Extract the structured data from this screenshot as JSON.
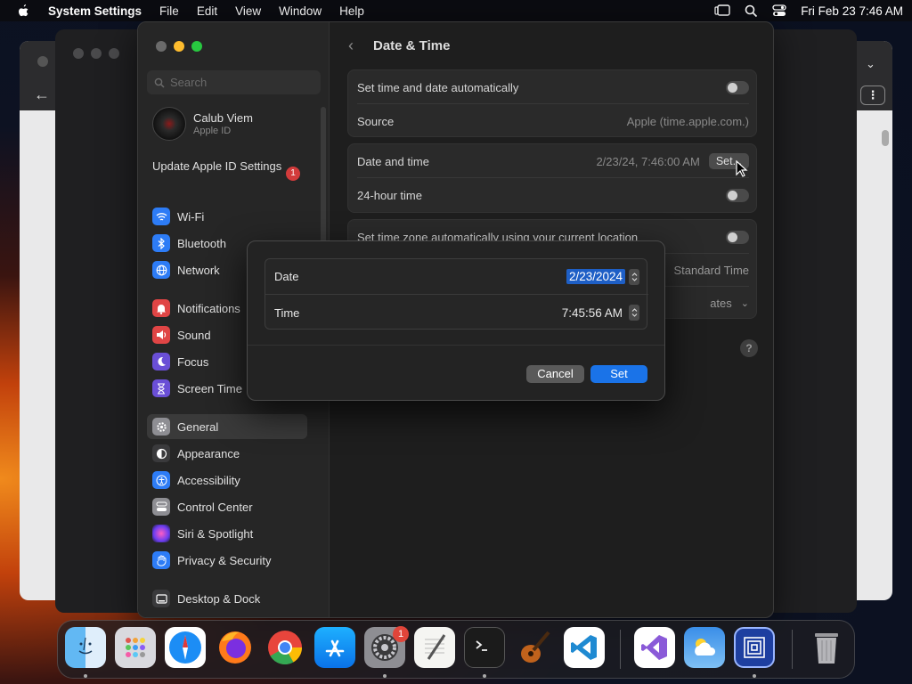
{
  "menubar": {
    "app_name": "System Settings",
    "menus": [
      "File",
      "Edit",
      "View",
      "Window",
      "Help"
    ],
    "clock": "Fri Feb 23  7:46 AM"
  },
  "sidebar": {
    "search_placeholder": "Search",
    "account": {
      "name": "Calub Viem",
      "subtitle": "Apple ID"
    },
    "update": {
      "label": "Update Apple ID Settings",
      "badge": "1"
    },
    "items": [
      {
        "label": "Wi-Fi",
        "icon": "wifi-icon",
        "color": "#2d7cf6"
      },
      {
        "label": "Bluetooth",
        "icon": "bluetooth-icon",
        "color": "#2d7cf6"
      },
      {
        "label": "Network",
        "icon": "globe-icon",
        "color": "#2d7cf6"
      },
      {
        "label": "Notifications",
        "icon": "bell-icon",
        "color": "#e04545"
      },
      {
        "label": "Sound",
        "icon": "speaker-icon",
        "color": "#e04545"
      },
      {
        "label": "Focus",
        "icon": "moon-icon",
        "color": "#6a4fd6"
      },
      {
        "label": "Screen Time",
        "icon": "hourglass-icon",
        "color": "#6a4fd6"
      },
      {
        "label": "General",
        "icon": "gear-icon",
        "color": "#8e8e93"
      },
      {
        "label": "Appearance",
        "icon": "appearance-icon",
        "color": "#3a3a3c"
      },
      {
        "label": "Accessibility",
        "icon": "accessibility-icon",
        "color": "#2d7cf6"
      },
      {
        "label": "Control Center",
        "icon": "control-center-icon",
        "color": "#8e8e93"
      },
      {
        "label": "Siri & Spotlight",
        "icon": "siri-icon",
        "color": "#b044d8"
      },
      {
        "label": "Privacy & Security",
        "icon": "hand-icon",
        "color": "#2d7cf6"
      },
      {
        "label": "Desktop & Dock",
        "icon": "dock-icon",
        "color": "#3a3a3c"
      }
    ],
    "selected": "General"
  },
  "content": {
    "title": "Date & Time",
    "rows": {
      "auto_set": {
        "label": "Set time and date automatically"
      },
      "source": {
        "label": "Source",
        "value": "Apple (time.apple.com.)"
      },
      "date_time": {
        "label": "Date and time",
        "value": "2/23/24, 7:46:00 AM",
        "button": "Set..."
      },
      "hour24": {
        "label": "24-hour time"
      },
      "tz_auto": {
        "label": "Set time zone automatically using your current location"
      },
      "tz_value": "Standard Time",
      "city_value": "ates"
    },
    "help": "?"
  },
  "dialog": {
    "date_label": "Date",
    "date_value": "2/23/2024",
    "time_label": "Time",
    "time_value": "7:45:56 AM",
    "cancel": "Cancel",
    "set": "Set"
  },
  "dock": {
    "items": [
      "Finder",
      "Launchpad",
      "Safari",
      "Firefox",
      "Chrome",
      "App Store",
      "System Settings",
      "TextEdit",
      "Terminal",
      "GarageBand",
      "Visual Studio Code",
      "Visual Studio",
      "Weather",
      "Hollow Knight",
      "Trash"
    ],
    "settings_badge": "1"
  }
}
